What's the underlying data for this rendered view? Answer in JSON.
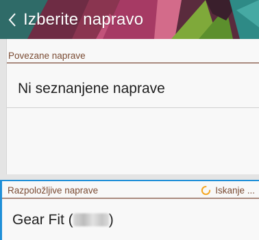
{
  "header": {
    "title": "Izberite napravo"
  },
  "paired_section": {
    "title": "Povezane naprave",
    "empty_text": "Ni seznanjene naprave"
  },
  "available_section": {
    "title": "Razpoložljive naprave",
    "status": "Iskanje ...",
    "devices": [
      {
        "name_prefix": "Gear Fit (",
        "name_suffix": ")"
      }
    ]
  },
  "colors": {
    "accent_blue": "#1f8fd8",
    "section_title": "#7a4b33",
    "spinner": "#f5a623"
  }
}
